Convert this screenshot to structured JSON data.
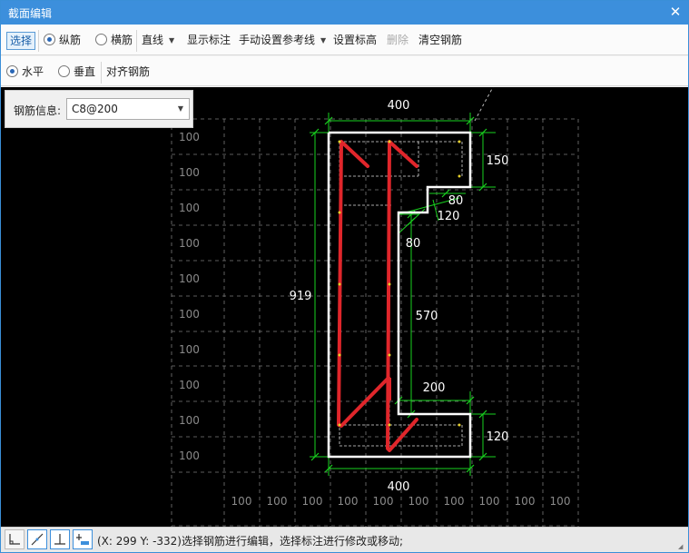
{
  "window": {
    "title": "截面编辑",
    "close_glyph": "✕"
  },
  "toolbar1": {
    "select": "选择",
    "longitudinal": "纵筋",
    "transverse": "横筋",
    "line_mode": "直线",
    "show_dims": "显示标注",
    "manual_ref": "手动设置参考线",
    "set_elevation": "设置标高",
    "delete": "删除",
    "clear_rebar": "清空钢筋"
  },
  "toolbar2": {
    "horizontal": "水平",
    "vertical": "垂直",
    "align_rebar": "对齐钢筋"
  },
  "rebar_info": {
    "label": "钢筋信息:",
    "value": "C8@200"
  },
  "drawing": {
    "dims": {
      "top_width": "400",
      "bottom_width": "400",
      "height": "919",
      "flange_top": "150",
      "step_a": "80",
      "step_b": "120",
      "step_c": "80",
      "web": "570",
      "bottom_flange_width": "200",
      "bottom_flange_height": "120"
    },
    "grid_left_labels": [
      "100",
      "100",
      "100",
      "100",
      "100",
      "100",
      "100",
      "100",
      "100",
      "100"
    ],
    "grid_bottom_labels": [
      "100",
      "100",
      "100",
      "100",
      "100",
      "100",
      "100",
      "100",
      "100",
      "100"
    ],
    "colors": {
      "section": "#ffffff",
      "rebar": "#e0262b",
      "dimension": "#19d21f",
      "grid": "#7a7a7a"
    }
  },
  "statusbar": {
    "text": "(X: 299 Y: -332)选择钢筋进行编辑，选择标注进行修改或移动;"
  }
}
